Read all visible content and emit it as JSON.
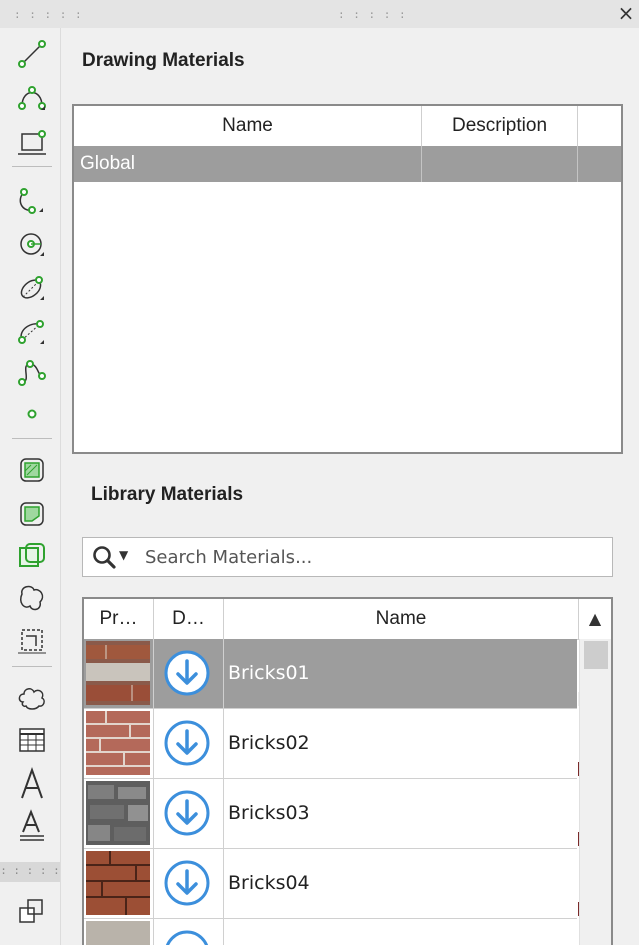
{
  "window": {
    "close_glyph": "×"
  },
  "drawing_materials": {
    "title": "Drawing Materials",
    "columns": {
      "name": "Name",
      "description": "Description"
    },
    "rows": [
      {
        "name": "Global",
        "description": ""
      }
    ]
  },
  "library_materials": {
    "title": "Library Materials",
    "search_placeholder": "Search Materials...",
    "columns": {
      "preview": "Pr…",
      "download": "D…",
      "name": "Name"
    },
    "rows": [
      {
        "name": "Bricks01",
        "selected": true
      },
      {
        "name": "Bricks02",
        "selected": false
      },
      {
        "name": "Bricks03",
        "selected": false
      },
      {
        "name": "Bricks04",
        "selected": false
      }
    ]
  },
  "colors": {
    "accent_blue": "#3c8fdc",
    "tool_green": "#2fa22f",
    "selection_gray": "#9d9d9d"
  },
  "icons": [
    "line-icon",
    "polyline-icon",
    "rectangle-icon",
    "arc-icon",
    "circle-icon",
    "ellipse-icon",
    "elliptical-arc-icon",
    "spline-icon",
    "point-icon",
    "hatch-icon",
    "region-icon",
    "boundary-icon",
    "revision-cloud-icon",
    "wipeout-icon",
    "cloud-icon",
    "table-icon",
    "multiline-text-icon",
    "single-line-text-icon",
    "block-icon"
  ]
}
